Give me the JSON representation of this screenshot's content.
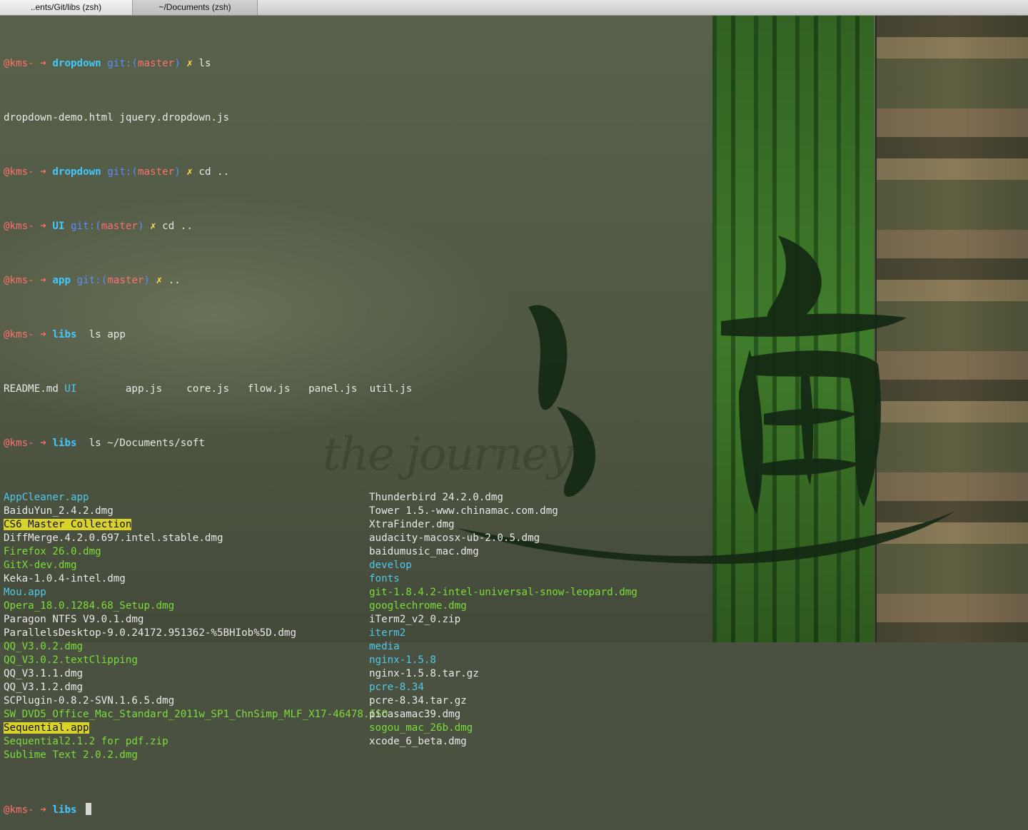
{
  "tabs": [
    {
      "label": "..ents/Git/libs (zsh)",
      "active": true
    },
    {
      "label": "~/Documents (zsh)",
      "active": false
    }
  ],
  "background": {
    "watermark": "the journey"
  },
  "prompts": [
    {
      "user": "@kms-",
      "arrow": "➜",
      "dir": "dropdown",
      "git": "git:(",
      "branch": "master",
      "git_close": ")",
      "dirty": "✗",
      "cmd": "ls"
    },
    {
      "user": "@kms-",
      "arrow": "➜",
      "dir": "dropdown",
      "git": "git:(",
      "branch": "master",
      "git_close": ")",
      "dirty": "✗",
      "cmd": "cd .."
    },
    {
      "user": "@kms-",
      "arrow": "➜",
      "dir": "UI",
      "git": "git:(",
      "branch": "master",
      "git_close": ")",
      "dirty": "✗",
      "cmd": "cd .."
    },
    {
      "user": "@kms-",
      "arrow": "➜",
      "dir": "app",
      "git": "git:(",
      "branch": "master",
      "git_close": ")",
      "dirty": "✗",
      "cmd": ".."
    },
    {
      "user": "@kms-",
      "arrow": "➜",
      "dir": "libs",
      "cmd": "ls app"
    },
    {
      "user": "@kms-",
      "arrow": "➜",
      "dir": "libs",
      "cmd": "ls ~/Documents/soft"
    },
    {
      "user": "@kms-",
      "arrow": "➜",
      "dir": "libs",
      "cmd": ""
    }
  ],
  "outputs": {
    "ls_dropdown": "dropdown-demo.html jquery.dropdown.js",
    "ls_app": [
      {
        "text": "README.md",
        "type": "plain"
      },
      {
        "text": "UI",
        "type": "dir"
      },
      {
        "text": "app.js",
        "type": "plain"
      },
      {
        "text": "core.js",
        "type": "plain"
      },
      {
        "text": "flow.js",
        "type": "plain"
      },
      {
        "text": "panel.js",
        "type": "plain"
      },
      {
        "text": "util.js",
        "type": "plain"
      }
    ],
    "soft_col1": [
      {
        "text": "AppCleaner.app",
        "type": "app"
      },
      {
        "text": "BaiduYun_2.4.2.dmg",
        "type": "plain"
      },
      {
        "text": "CS6 Master Collection",
        "type": "hl"
      },
      {
        "text": "DiffMerge.4.2.0.697.intel.stable.dmg",
        "type": "plain"
      },
      {
        "text": "Firefox 26.0.dmg",
        "type": "exec"
      },
      {
        "text": "GitX-dev.dmg",
        "type": "exec"
      },
      {
        "text": "Keka-1.0.4-intel.dmg",
        "type": "plain"
      },
      {
        "text": "Mou.app",
        "type": "app"
      },
      {
        "text": "Opera_18.0.1284.68_Setup.dmg",
        "type": "exec"
      },
      {
        "text": "Paragon NTFS V9.0.1.dmg",
        "type": "plain"
      },
      {
        "text": "ParallelsDesktop-9.0.24172.951362-%5BHIob%5D.dmg",
        "type": "plain"
      },
      {
        "text": "QQ_V3.0.2.dmg",
        "type": "exec"
      },
      {
        "text": "QQ_V3.0.2.textClipping",
        "type": "exec"
      },
      {
        "text": "QQ_V3.1.1.dmg",
        "type": "plain"
      },
      {
        "text": "QQ_V3.1.2.dmg",
        "type": "plain"
      },
      {
        "text": "SCPlugin-0.8.2-SVN.1.6.5.dmg",
        "type": "plain"
      },
      {
        "text": "SW_DVD5_Office_Mac_Standard_2011w_SP1_ChnSimp_MLF_X17-46478.ISO",
        "type": "exec"
      },
      {
        "text": "Sequential.app",
        "type": "hl"
      },
      {
        "text": "Sequential2.1.2 for pdf.zip",
        "type": "exec"
      },
      {
        "text": "Sublime Text 2.0.2.dmg",
        "type": "exec"
      }
    ],
    "soft_col2": [
      {
        "text": "Thunderbird 24.2.0.dmg",
        "type": "plain"
      },
      {
        "text": "Tower 1.5.-www.chinamac.com.dmg",
        "type": "plain"
      },
      {
        "text": "XtraFinder.dmg",
        "type": "plain"
      },
      {
        "text": "audacity-macosx-ub-2.0.5.dmg",
        "type": "plain"
      },
      {
        "text": "baidumusic_mac.dmg",
        "type": "plain"
      },
      {
        "text": "develop",
        "type": "dir"
      },
      {
        "text": "fonts",
        "type": "dir"
      },
      {
        "text": "git-1.8.4.2-intel-universal-snow-leopard.dmg",
        "type": "exec"
      },
      {
        "text": "googlechrome.dmg",
        "type": "exec"
      },
      {
        "text": "iTerm2_v2_0.zip",
        "type": "plain"
      },
      {
        "text": "iterm2",
        "type": "dir"
      },
      {
        "text": "media",
        "type": "dir"
      },
      {
        "text": "nginx-1.5.8",
        "type": "dir"
      },
      {
        "text": "nginx-1.5.8.tar.gz",
        "type": "plain"
      },
      {
        "text": "pcre-8.34",
        "type": "dir"
      },
      {
        "text": "pcre-8.34.tar.gz",
        "type": "plain"
      },
      {
        "text": "picasamac39.dmg",
        "type": "plain"
      },
      {
        "text": "sogou_mac_26b.dmg",
        "type": "exec"
      },
      {
        "text": "xcode_6_beta.dmg",
        "type": "plain"
      }
    ]
  },
  "colors": {
    "prompt_user": "#ff6e6e",
    "prompt_dir": "#42c8ff",
    "git_label": "#5a8cff",
    "dirty_mark": "#ffe14a",
    "exec_file": "#7bdc3a",
    "app_dir": "#4fc8e8",
    "highlight_bg": "#d8d22a"
  }
}
